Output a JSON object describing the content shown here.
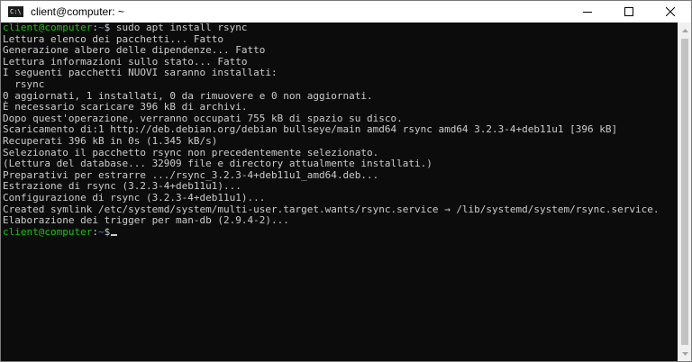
{
  "window": {
    "title": "client@computer: ~",
    "icon_name": "console-icon",
    "icon_text": "C:\\"
  },
  "prompt": {
    "user": "client@computer",
    "path": "~",
    "symbol": "$"
  },
  "command": "sudo apt install rsync",
  "output": [
    "Lettura elenco dei pacchetti... Fatto",
    "Generazione albero delle dipendenze... Fatto",
    "Lettura informazioni sullo stato... Fatto",
    "I seguenti pacchetti NUOVI saranno installati:",
    "  rsync",
    "0 aggiornati, 1 installati, 0 da rimuovere e 0 non aggiornati.",
    "È necessario scaricare 396 kB di archivi.",
    "Dopo quest'operazione, verranno occupati 755 kB di spazio su disco.",
    "Scaricamento di:1 http://deb.debian.org/debian bullseye/main amd64 rsync amd64 3.2.3-4+deb11u1 [396 kB]",
    "Recuperati 396 kB in 0s (1.345 kB/s)",
    "Selezionato il pacchetto rsync non precedentemente selezionato.",
    "(Lettura del database... 32909 file e directory attualmente installati.)",
    "Preparativi per estrarre .../rsync_3.2.3-4+deb11u1_amd64.deb...",
    "Estrazione di rsync (3.2.3-4+deb11u1)...",
    "Configurazione di rsync (3.2.3-4+deb11u1)...",
    "Created symlink /etc/systemd/system/multi-user.target.wants/rsync.service → /lib/systemd/system/rsync.service.",
    "Elaborazione dei trigger per man-db (2.9.4-2)..."
  ],
  "colors": {
    "background": "#0c0c0c",
    "text": "#cccccc",
    "prompt_user": "#16c60c",
    "prompt_path": "#3b78ff",
    "titlebar": "#ffffff"
  }
}
